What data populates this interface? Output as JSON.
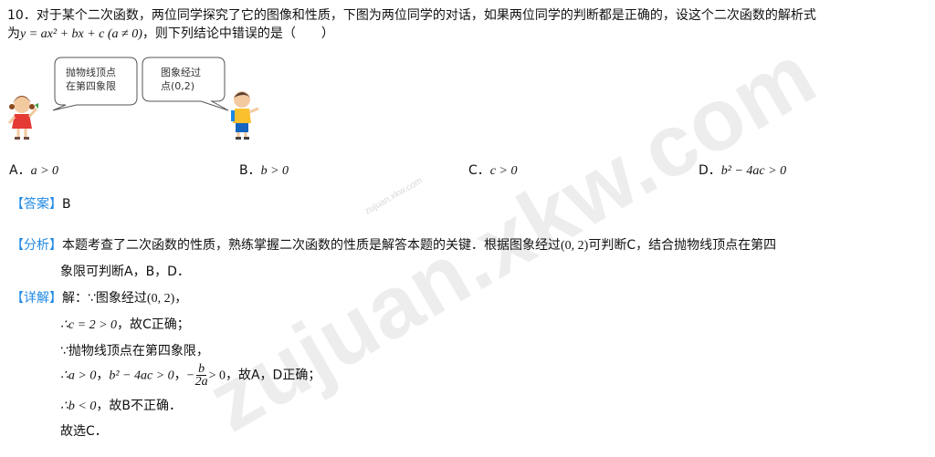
{
  "watermark": "zujuan.xkw.com",
  "watermark_small": "zujuan.xkw.com",
  "question": {
    "number": "10",
    "text_1": "对于某个二次函数，两位同学探究了它的图像和性质，下图为两位同学的对话，如果两位同学的判断都是正确的，设这个二次函数的解析式",
    "text_2a": "为",
    "formula": "y = ax² + bx + c (a ≠ 0)",
    "text_2b": "，则下列结论中错误的是（　　）"
  },
  "bubbles": {
    "left_line1": "抛物线顶点",
    "left_line2": "在第四象限",
    "right_line1": "图象经过",
    "right_line2": "点(0,2)"
  },
  "options": [
    {
      "letter": "A．",
      "expr": "a > 0"
    },
    {
      "letter": "B．",
      "expr": "b > 0"
    },
    {
      "letter": "C．",
      "expr": "c > 0"
    },
    {
      "letter": "D．",
      "expr": "b² − 4ac > 0"
    }
  ],
  "answer": {
    "tag": "【答案】",
    "value": "B"
  },
  "analysis": {
    "tag": "【分析】",
    "line1a": "本题考查了二次函数的性质，熟练掌握二次函数的性质是解答本题的关键．根据图象经过",
    "point": "(0, 2)",
    "line1b": "可判断C，结合抛物线顶点在第四",
    "line2": "象限可判断A，B，D．"
  },
  "detail": {
    "tag": "【详解】",
    "line1a": "解：∵图象经过",
    "line1_point": "(0, 2)",
    "line1b": "，",
    "line2_math": "∴c = 2 > 0",
    "line2_text": "，故C正确；",
    "line3": "∵抛物线顶点在第四象限，",
    "line4_a": "∴a > 0",
    "line4_b": "b² − 4ac > 0",
    "line4_neg": "−",
    "line4_frac_num": "b",
    "line4_frac_den": "2a",
    "line4_gt": "> 0",
    "line4_sep": "，",
    "line4_text": "，故A，D正确；",
    "line5_math": "∴b < 0",
    "line5_text": "，故B不正确．",
    "line6": "故选C．"
  }
}
